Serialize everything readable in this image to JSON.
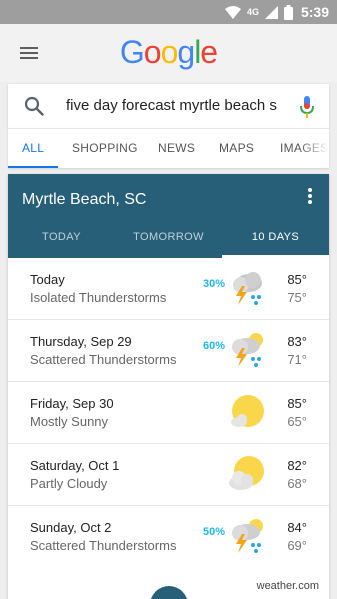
{
  "status_bar": {
    "network": "4G",
    "time": "5:39",
    "icons": [
      "wifi-icon",
      "signal-icon",
      "battery-icon"
    ]
  },
  "header": {
    "logo_letters": [
      {
        "char": "G",
        "color": "#4285F4"
      },
      {
        "char": "o",
        "color": "#EA4335"
      },
      {
        "char": "o",
        "color": "#FBBC05"
      },
      {
        "char": "g",
        "color": "#4285F4"
      },
      {
        "char": "l",
        "color": "#34A853"
      },
      {
        "char": "e",
        "color": "#EA4335"
      }
    ]
  },
  "search": {
    "query": "five day forecast myrtle beach s"
  },
  "tabs": [
    {
      "label": "ALL",
      "active": true
    },
    {
      "label": "SHOPPING",
      "active": false
    },
    {
      "label": "NEWS",
      "active": false
    },
    {
      "label": "MAPS",
      "active": false
    },
    {
      "label": "IMAGES",
      "active": false
    }
  ],
  "weather": {
    "location": "Myrtle Beach, SC",
    "header_color": "#275f79",
    "day_tabs": [
      {
        "label": "TODAY",
        "active": false
      },
      {
        "label": "TOMORROW",
        "active": false
      },
      {
        "label": "10 DAYS",
        "active": true
      }
    ],
    "forecast": [
      {
        "day": "Today",
        "condition": "Isolated Thunderstorms",
        "precip": "30%",
        "high": "85°",
        "low": "75°",
        "icon": "thunderstorm-icon"
      },
      {
        "day": "Thursday, Sep 29",
        "condition": "Scattered Thunderstorms",
        "precip": "60%",
        "high": "83°",
        "low": "71°",
        "icon": "scattered-thunderstorm-icon"
      },
      {
        "day": "Friday, Sep 30",
        "condition": "Mostly Sunny",
        "precip": "",
        "high": "85°",
        "low": "65°",
        "icon": "mostly-sunny-icon"
      },
      {
        "day": "Saturday, Oct 1",
        "condition": "Partly Cloudy",
        "precip": "",
        "high": "82°",
        "low": "68°",
        "icon": "partly-cloudy-icon"
      },
      {
        "day": "Sunday, Oct 2",
        "condition": "Scattered Thunderstorms",
        "precip": "50%",
        "high": "84°",
        "low": "69°",
        "icon": "scattered-thunderstorm-icon"
      }
    ],
    "source": "weather.com"
  }
}
